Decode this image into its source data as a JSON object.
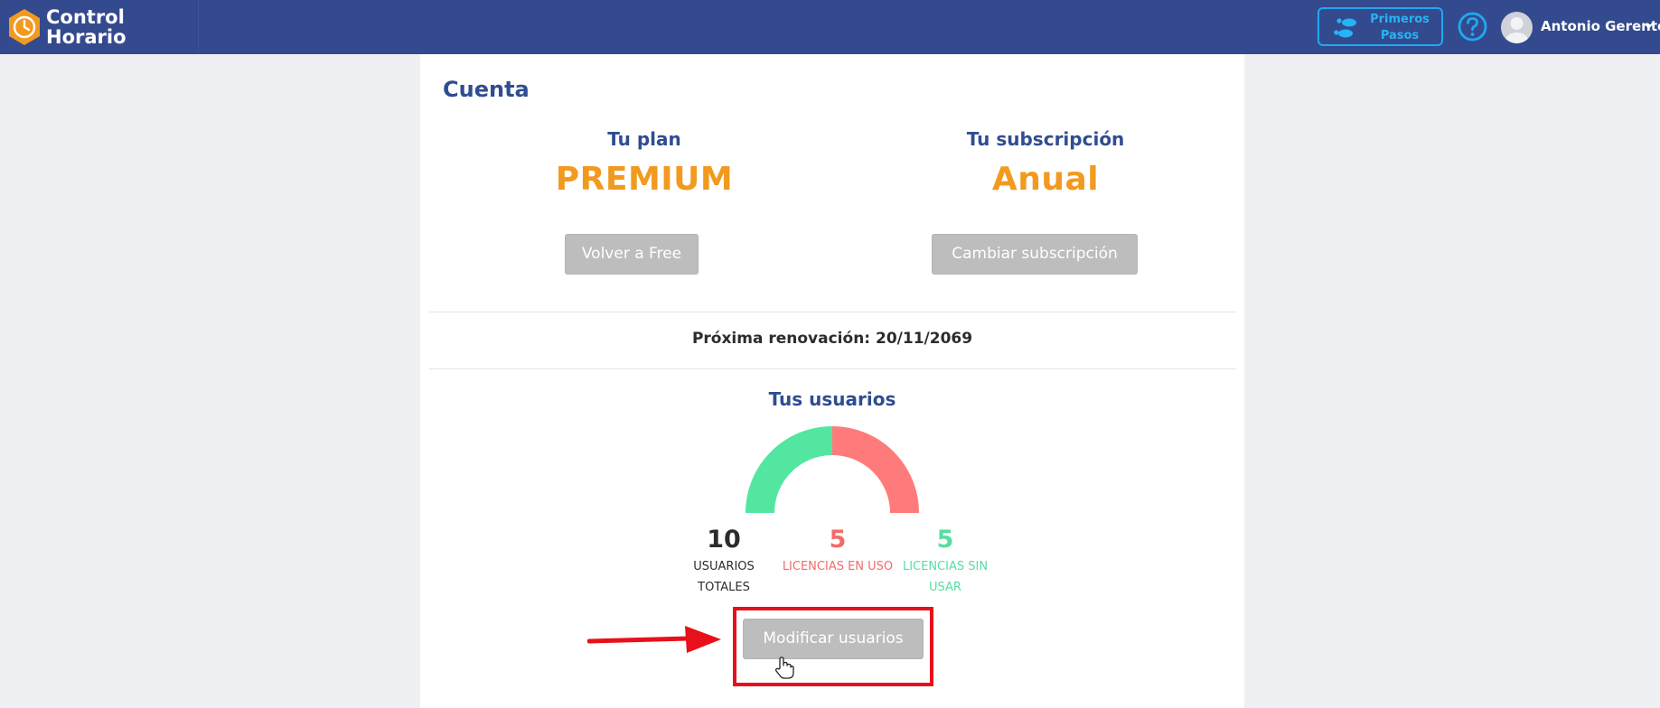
{
  "header": {
    "brand_line1": "Control",
    "brand_line2": "Horario",
    "brand_icon": "clock-hexagon-icon",
    "first_steps_line1": "Primeros",
    "first_steps_line2": "Pasos",
    "first_steps_icon": "footprints-icon",
    "help_icon": "question-circle-icon",
    "user_name": "Antonio Gerente",
    "colors": {
      "bar": "#344a8e",
      "accent": "#1fa9f0",
      "logo": "#f29a1f"
    }
  },
  "account": {
    "title": "Cuenta",
    "plan_title": "Tu plan",
    "plan_value": "PREMIUM",
    "plan_button": "Volver a Free",
    "subscription_title": "Tu subscripción",
    "subscription_value": "Anual",
    "subscription_button": "Cambiar subscripción",
    "renewal": "Próxima renovación: 20/11/2069"
  },
  "users": {
    "title": "Tus usuarios",
    "gauge": {
      "used": 5,
      "unused": 5,
      "used_color": "#ff7b7b",
      "unused_color": "#52e6a0"
    },
    "total_value": "10",
    "total_label_line1": "USUARIOS",
    "total_label_line2": "TOTALES",
    "used_value": "5",
    "used_label": "LICENCIAS EN USO",
    "unused_value": "5",
    "unused_label_line1": "LICENCIAS SIN",
    "unused_label_line2": "USAR",
    "modify_button": "Modificar usuarios"
  },
  "annotation": {
    "highlight_color": "#e8101a",
    "pointer": "hand-cursor-icon",
    "arrow": "red-arrow"
  }
}
